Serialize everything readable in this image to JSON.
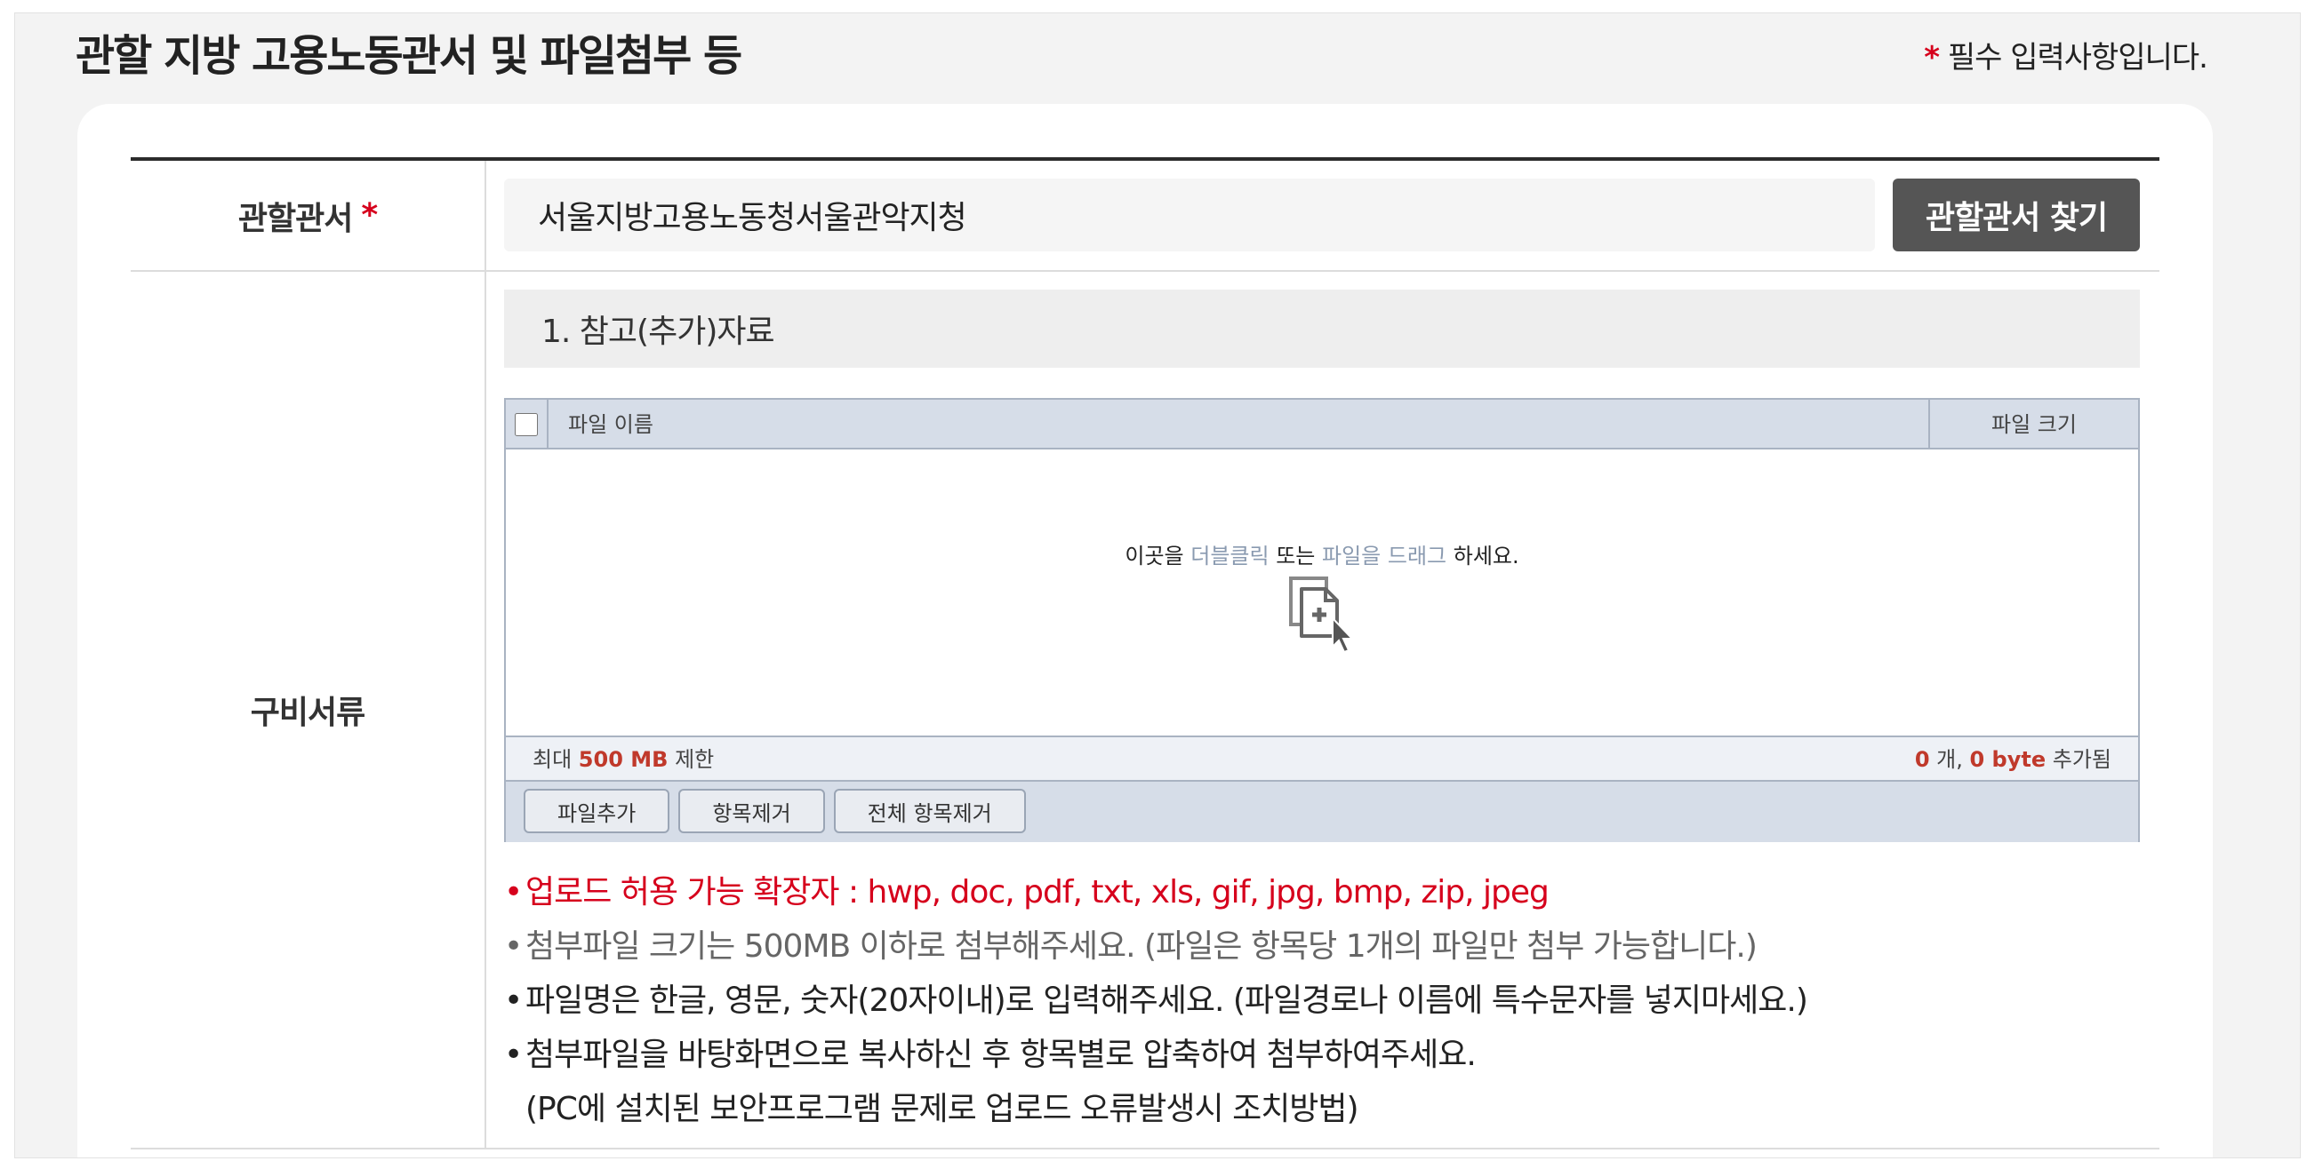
{
  "section": {
    "title": "관할 지방 고용노동관서 및 파일첨부 등",
    "required_star": "*",
    "required_note": " 필수 입력사항입니다."
  },
  "office": {
    "label": "관할관서",
    "required_star": "*",
    "value": "서울지방고용노동청서울관악지청",
    "find_button": "관할관서 찾기"
  },
  "docs": {
    "label": "구비서류",
    "subsection_title": "1. 참고(추가)자료",
    "uploader": {
      "col_name": "파일 이름",
      "col_size": "파일 크기",
      "drop_pre": "이곳을 ",
      "drop_dblclick": "더블클릭",
      "drop_mid": " 또는 ",
      "drop_drag": "파일을 드래그",
      "drop_post": " 하세요.",
      "limit_pre": "최대 ",
      "limit_value": "500 MB",
      "limit_post": " 제한",
      "count_value": "0",
      "count_unit": " 개, ",
      "bytes_value": "0 byte",
      "bytes_post": " 추가됨",
      "btn_add": "파일추가",
      "btn_remove": "항목제거",
      "btn_remove_all": "전체 항목제거"
    },
    "notes": {
      "bullet": "•",
      "n1": "업로드 허용 가능 확장자 : hwp, doc, pdf, txt, xls, gif, jpg, bmp, zip, jpeg",
      "n2": "첨부파일 크기는 500MB 이하로 첨부해주세요. (파일은 항목당 1개의 파일만 첨부 가능합니다.)",
      "n3": "파일명은 한글, 영문, 숫자(20자이내)로 입력해주세요. (파일경로나 이름에 특수문자를 넣지마세요.)",
      "n4": "첨부파일을 바탕화면으로 복사하신 후 항목별로 압축하여 첨부하여주세요.",
      "n5": "(PC에 설치된 보안프로그램 문제로 업로드 오류발생시 조치방법)"
    }
  },
  "icons": {
    "file_add": "file-add-icon",
    "cursor": "cursor-icon"
  },
  "colors": {
    "required": "#d6001c",
    "button_dark": "#555555",
    "uploader_header": "#d6dde8",
    "highlight": "#c0392b"
  }
}
